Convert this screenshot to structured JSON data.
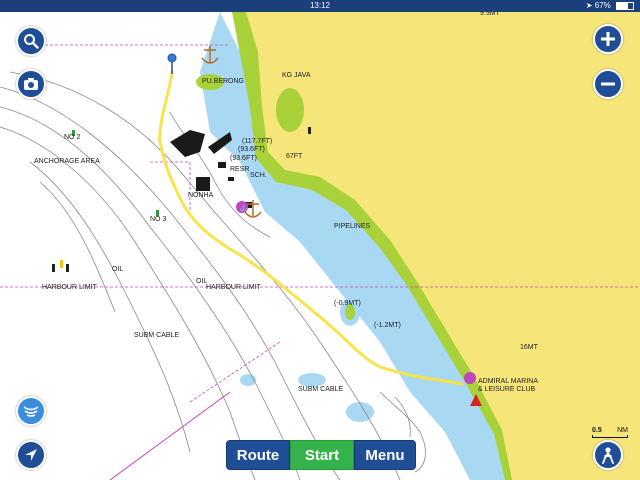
{
  "status_bar": {
    "time": "13:12",
    "battery": "67%",
    "battery_level": 0.67
  },
  "map_labels": {
    "depth_top_right": "9.3MT",
    "pu_berong": "PU.BERONG",
    "kg_java": "KG JAVA",
    "depth_117": "(117.7FT)",
    "depth_93a": "(93.6FT)",
    "depth_93b": "(93.6FT)",
    "depth_67": "67FT",
    "resr": "RESR",
    "sch": "SCH.",
    "no_2": "NO 2",
    "anchorage_area": "ANCHORAGE AREA",
    "nonha": "NONHA",
    "no_3": "NO 3",
    "pipelines": "PIPELINES",
    "oil_a": "OIL",
    "oil_b": "OIL",
    "harbour_limit_left": "HARBOUR LIMIT",
    "harbour_limit_mid": "HARBOUR LIMIT",
    "depth_09": "(-0.9MT)",
    "depth_12": "(-1.2MT)",
    "subm_cable_a": "SUBM CABLE",
    "subm_cable_b": "SUBM CABLE",
    "depth_16": "16MT",
    "admiral_marina_1": "ADMIRAL MARINA",
    "admiral_marina_2": "& LEISURE CLUB"
  },
  "bottom_bar": {
    "route": "Route",
    "start": "Start",
    "menu": "Menu"
  },
  "scale_bar": {
    "value": "0.5",
    "unit": "NM"
  },
  "icons": {
    "search": "search-icon",
    "camera": "camera-icon",
    "zoom_in": "plus-icon",
    "zoom_out": "minus-icon",
    "sonar": "sonar-icon",
    "locate": "navigation-arrow-icon",
    "person": "person-icon"
  },
  "colors": {
    "land": "#f6e67a",
    "shallow_green": "#a8d13a",
    "shallow_blue": "#a9d8f2",
    "deep_water": "#ffffff",
    "route_line": "#f8e34a",
    "button_blue": "#1f4e96",
    "start_green": "#35b34a",
    "status_bar": "#1a3f7a"
  }
}
